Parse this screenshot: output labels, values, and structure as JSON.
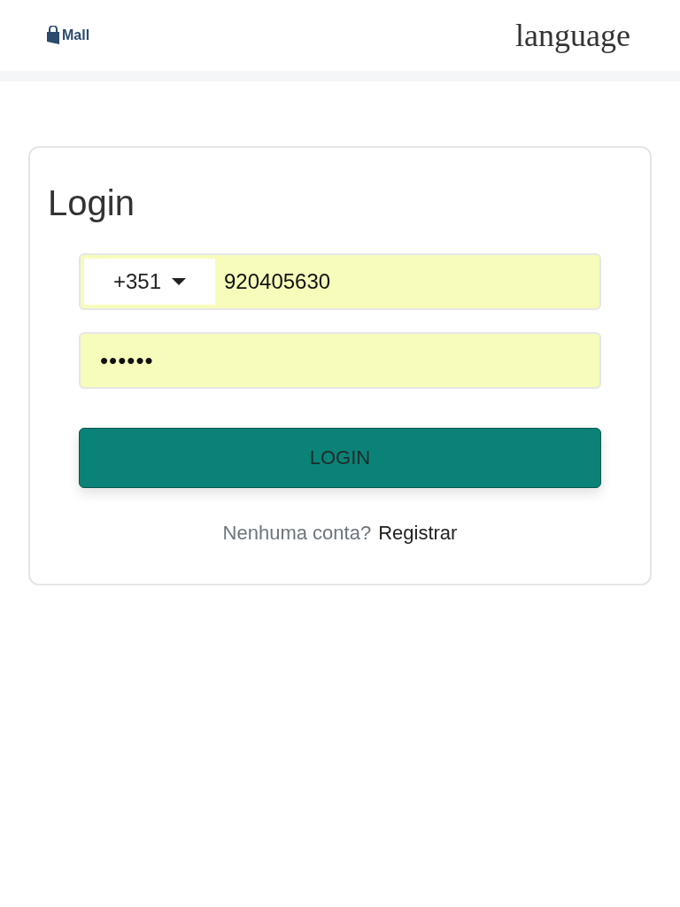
{
  "header": {
    "logo": "Mall",
    "language": "language"
  },
  "login": {
    "title": "Login",
    "country_code": "+351",
    "phone": "920405630",
    "password": "••••••",
    "button": "LOGIN",
    "prompt": "Nenhuma conta?",
    "register_link": "Registrar"
  }
}
